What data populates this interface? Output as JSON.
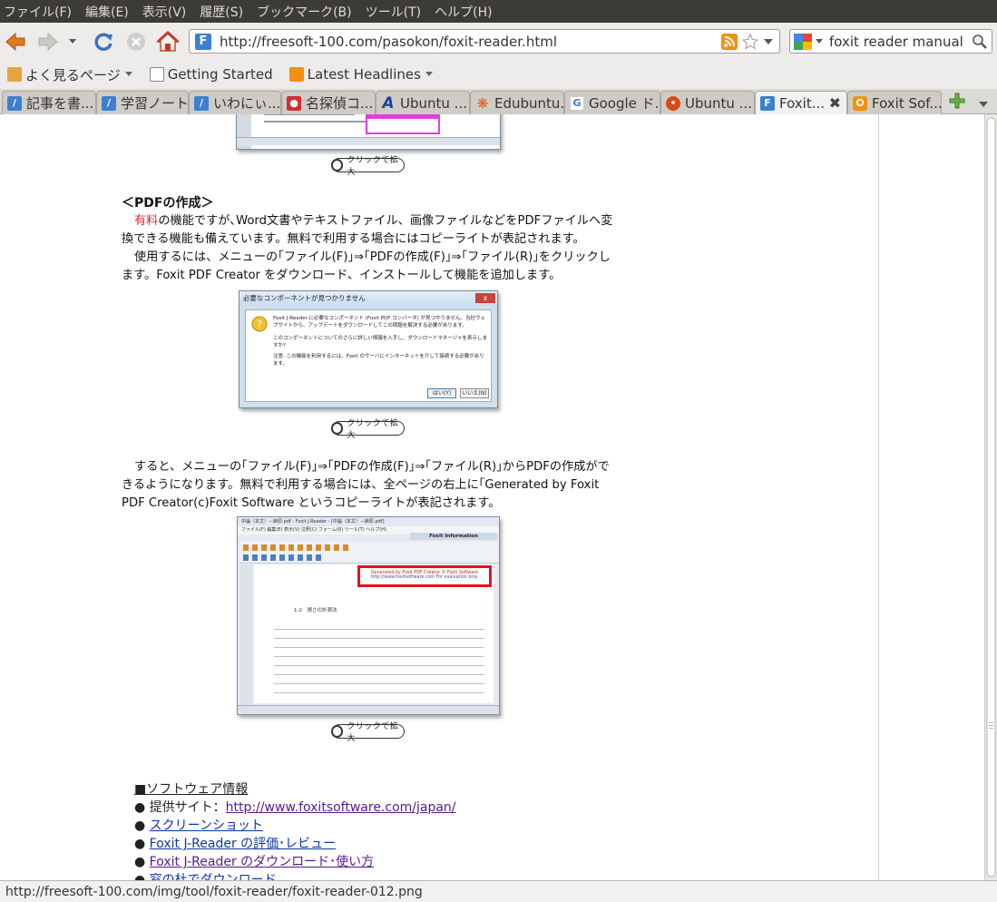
{
  "menubar": {
    "items": [
      "ファイル(F)",
      "編集(E)",
      "表示(V)",
      "履歴(S)",
      "ブックマーク(B)",
      "ツール(T)",
      "ヘルプ(H)"
    ]
  },
  "navbar": {
    "url": "http://freesoft-100.com/pasokon/foxit-reader.html",
    "search_query": "foxit reader manual"
  },
  "bookmarks": {
    "items": [
      "よく見るページ",
      "Getting Started",
      "Latest Headlines"
    ]
  },
  "tabs": [
    {
      "label": "記事を書...",
      "icon_color": "#3d7fd3"
    },
    {
      "label": "学習ノート",
      "icon_color": "#3d7fd3"
    },
    {
      "label": "いわにぃ...",
      "icon_color": "#3d7fd3"
    },
    {
      "label": "名探偵コ...",
      "icon_color": "#d0312d"
    },
    {
      "label": "Ubuntu ...",
      "icon_color": "#1f3f99"
    },
    {
      "label": "Edubuntu...",
      "icon_color": "#e25a1c"
    },
    {
      "label": "Google ド...",
      "icon_color": "#3c78d8"
    },
    {
      "label": "Ubuntu ...",
      "icon_color": "#dd4814"
    },
    {
      "label": "Foxit...",
      "icon_color": "#3d7fd3"
    },
    {
      "label": "Foxit Sof...",
      "icon_color": "#f29111"
    }
  ],
  "page": {
    "zoom_label": "クリックで拡大",
    "pdf_heading": "＜PDFの作成＞",
    "para1_red": "有料",
    "para1_rest": "の機能ですが､Word文書やテキストファイル、画像ファイルなどをPDFファイルへ変換できる機能も備えています。無料で利用する場合にはコピーライトが表記されます。",
    "para2": "使用するには、メニューの｢ファイル(F)｣⇒｢PDFの作成(F)｣⇒｢ファイル(R)｣をクリックします。Foxit PDF Creator をダウンロード、インストールして機能を追加します。",
    "para3": "すると、メニューの｢ファイル(F)｣⇒｢PDFの作成(F)｣⇒｢ファイル(R)｣からPDFの作成ができるようになります。無料で利用する場合には、全ページの右上に｢Generated by Foxit PDF Creator(c)Foxit Software というコピーライトが表記されます。",
    "dialog_title": "必要なコンポーネントが見つかりません",
    "dialog_text1": "Foxit J-Reader に必要なコンポーネント (Foxit PDF コンバータ) が見つかりません。当社ウェブサイトから、アップデートをダウンロードしてこの問題を解決する必要があります。",
    "dialog_text2": "このコンポーネントについてのさらに詳しい情報を入手し、ダウンロードマネージャを表示しますか?",
    "dialog_text3": "注意: この機能を利用するには、Foxit のサーバにインターネットを介して接続する必要があります。",
    "dialog_yes": "はい(Y)",
    "dialog_no": "いいえ(N)",
    "shot2_title": "中論（本文）－麻原.pdf - Foxit J-Reader - [中論（本文）－麻原.pdf]",
    "shot2_menu": "ファイル(F)  編集(E)  表示(V)  注釈(C)  フォーム(R)  ツール(T)  ヘルプ(H)",
    "shot2_info": "Foxit Information",
    "shot2_gen1": "Generated by Foxit PDF Creator © Foxit Software",
    "shot2_gen2": "http://www.foxitsoftware.com   For evaluation only.",
    "shot2_section": "1-2　視さの計測法"
  },
  "info": {
    "header": "■ソフトウェア情報",
    "site_label": "● 提供サイト：",
    "site_url": "http://www.foxitsoftware.com/japan/",
    "bullet": "●",
    "links": [
      "スクリーンショット",
      "Foxit J-Reader の評価･レビュー",
      "Foxit J-Reader のダウンロード･使い方",
      "窓の杜でダウンロード"
    ]
  },
  "statusbar": {
    "text": "http://freesoft-100.com/img/tool/foxit-reader/foxit-reader-012.png"
  }
}
